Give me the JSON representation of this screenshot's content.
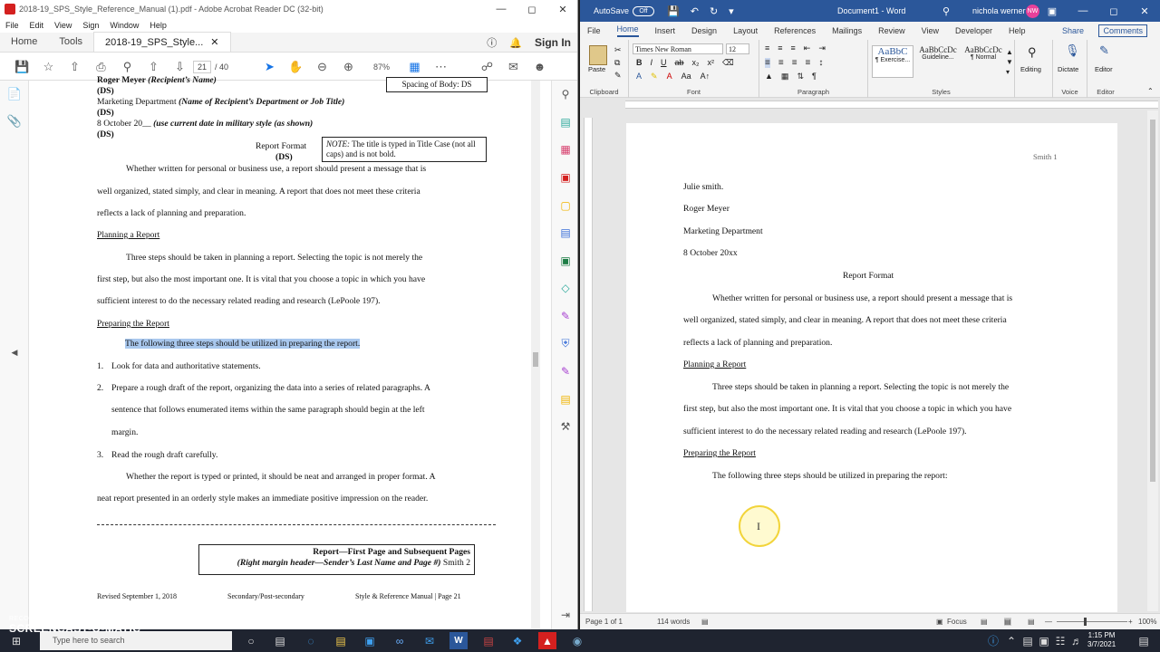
{
  "acrobat": {
    "title": "2018-19_SPS_Style_Reference_Manual (1).pdf - Adobe Acrobat Reader DC (32-bit)",
    "menu": [
      "File",
      "Edit",
      "View",
      "Sign",
      "Window",
      "Help"
    ],
    "tab_home": "Home",
    "tab_tools": "Tools",
    "tab_doc": "2018-19_SPS_Style...",
    "sign_in": "Sign In",
    "page_current": "21",
    "page_total": "/ 40",
    "zoom": "87%"
  },
  "pdf": {
    "l1a": "Roger Meyer ",
    "l1b": "(Recipient’s Name)",
    "spacing_box": "Spacing of Body:  DS",
    "ds1": "(DS)",
    "l2a": "Marketing Department ",
    "l2b": "(Name of Recipient’s Department or Job Title)",
    "ds2": "(DS)",
    "l3a": "8 October 20__ ",
    "l3b": "(use current date in military style (as shown)",
    "ds3": "(DS)",
    "title_label": "Report Format",
    "ds4": "(DS)",
    "note_label": "NOTE:",
    "note_text": "  The title is typed in Title Case (not all caps) and is not bold.",
    "p1": "Whether written for personal or business use, a report should present a message that is",
    "p2": "well organized, stated simply, and clear in meaning.  A report that does not meet these criteria",
    "p3": "reflects a lack of planning and preparation.",
    "h1": "Planning a Report",
    "p4": "Three steps should be taken in planning a report.  Selecting the topic is not merely the",
    "p5": "first step, but also the most important one.  It is vital that you choose a topic in which you have",
    "p6": "sufficient interest to do the necessary related reading and research (LePoole 197).",
    "h2": "Preparing the Report",
    "p7": "The following three steps should be utilized in preparing the report.",
    "n1": "1.",
    "i1": "Look for data and authoritative statements.",
    "n2": "2.",
    "i2a": "Prepare a rough draft of the report, organizing the data into a series of related paragraphs.  A",
    "i2b": "sentence that follows enumerated items within the same paragraph should begin at the left",
    "i2c": "margin.",
    "n3": "3.",
    "i3": "Read the rough draft carefully.",
    "p8": "Whether the report is typed or printed, it should be neat and arranged in proper format.  A",
    "p9": "neat report presented in an orderly style makes an immediate positive impression on the reader.",
    "box2_title": "Report—First Page and Subsequent Pages",
    "box2_sub": "(Right margin header—Sender’s Last Name and Page #)",
    "box2_smith": " Smith 2",
    "footer_left": "Revised September 1, 2018",
    "footer_mid": "Secondary/Post-secondary",
    "footer_right": "Style & Reference Manual | Page 21"
  },
  "word": {
    "autosave": "AutoSave",
    "autosave_state": "Off",
    "doc_title": "Document1 - Word",
    "user_name": "nichola werner",
    "user_initials": "NW",
    "tabs": [
      "File",
      "Home",
      "Insert",
      "Design",
      "Layout",
      "References",
      "Mailings",
      "Review",
      "View",
      "Developer",
      "Help"
    ],
    "share": "Share",
    "comments": "Comments",
    "font_name": "Times New Roman",
    "font_size": "12",
    "paste": "Paste",
    "grp_clipboard": "Clipboard",
    "grp_font": "Font",
    "grp_paragraph": "Paragraph",
    "grp_styles": "Styles",
    "grp_voice": "Voice",
    "grp_editor": "Editor",
    "style1_sample": "AaBbC",
    "style1_name": "¶ Exercise...",
    "style2_sample": "AaBbCcDc",
    "style2_name": "Guideline...",
    "style3_sample": "AaBbCcDc",
    "style3_name": "¶ Normal",
    "editing": "Editing",
    "dictate": "Dictate",
    "editor": "Editor",
    "status_page": "Page 1 of 1",
    "status_words": "114 words",
    "status_focus": "Focus",
    "status_zoom": "100%"
  },
  "wdoc": {
    "header": "Smith 1",
    "l1": "Julie smith.",
    "l2": "Roger Meyer",
    "l3": "Marketing Department",
    "l4": "8 October 20xx",
    "title": "Report Format",
    "p1": "Whether written for personal or business use, a report should present a message that is",
    "p2": "well organized, stated simply, and clear in meaning. A report that does not meet these criteria",
    "p3": "reflects a lack of planning and preparation.",
    "h1": "Planning a Report",
    "p4": "Three steps should be taken in planning a report. Selecting the topic is not merely the",
    "p5": "first step, but also the most important one. It is vital that you choose a topic in which you have",
    "p6": "sufficient interest to do the necessary related reading and research (LePoole 197).",
    "h2": "Preparing the Report",
    "p7": "The following three steps should be utilized in preparing the report:"
  },
  "taskbar": {
    "search_placeholder": "Type here to search",
    "time": "1:15 PM",
    "date": "3/7/2021"
  },
  "watermark": {
    "top": "RECORDED WITH",
    "brand": "SCREENCAST-O-MATIC"
  }
}
